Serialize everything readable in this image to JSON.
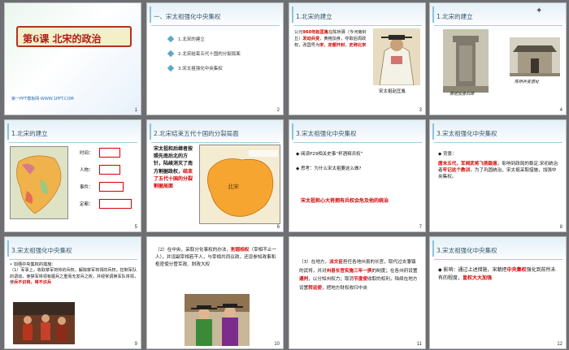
{
  "slides": [
    {
      "num": "1",
      "title": "第6课  北宋的政治",
      "watermark": "第一PPT模板网-WWW.1PPT.COM"
    },
    {
      "num": "2",
      "header": "一、宋太祖强化中央集权",
      "items": [
        "1.北宋的建立",
        "2.北宋结束五代十国的分裂局面",
        "3.宋太祖强化中央集权"
      ]
    },
    {
      "num": "3",
      "header": "1.北宋的建立",
      "text_parts": [
        "公元",
        "960年",
        "赵匡胤",
        "在陈桥驿（今河南封丘）",
        "发动兵变",
        "，黄袍加身，夺取后周政权，改国号为",
        "宋",
        "，",
        "定都开封",
        "，",
        "史称北宋"
      ],
      "caption": "宋太祖赵匡胤"
    },
    {
      "num": "4",
      "header": "1.北宋的建立",
      "caption1": "黄袍加身石碑",
      "caption2": "陈桥兵变遗址"
    },
    {
      "num": "5",
      "header": "1.北宋的建立",
      "fields": [
        "时间：",
        "人物：",
        "事件：",
        "定都："
      ]
    },
    {
      "num": "6",
      "header": "2.北宋结束五代十国的分裂局面",
      "text_black": "宋太祖和后继者按照先南后北的方针，陆续消灭了南方割据政权，",
      "text_red": "结束了五代十国的分裂割据局面",
      "map_label": "北宋"
    },
    {
      "num": "7",
      "header": "3.宋太祖强化中央集权",
      "q1": "阅读P29相关史事“杯酒释兵权”",
      "q2": "思考：为什么宋太祖要这么做?",
      "answer": "宋太祖担心大将拥有兵权会危及他的统治"
    },
    {
      "num": "8",
      "header": "3.宋太祖强化中央集权",
      "label": "背景：",
      "text_parts": [
        "唐末五代，",
        "军阀武将飞扬跋扈",
        "，影响到政局的稳定,宋初统治者",
        "牢记这个教训",
        "，为了巩固统治，宋太祖采取措施，加强中央集权。"
      ]
    },
    {
      "num": "9",
      "header": "3.宋太祖强化中央集权",
      "sub": "加强中央集权的措施：",
      "text_black": "（1）军事上，收取禁军将帅的兵权，解除禁军将领的兵权，控制军队的调动，使禁军将领有握兵之重而无发兵之权，并经常调换军队将领，使",
      "text_red": "兵不识将，将不识兵"
    },
    {
      "num": "10",
      "text_parts": [
        "（2）在中央，",
        "采取分化事权的办法，",
        "削弱相权",
        "（宰相不止一人），并设副宰相若干人，与宰相共同议政，还设参知政事和枢密使分管军政、财政大权"
      ]
    },
    {
      "num": "11",
      "text_parts": [
        "（3）在地方，",
        "派文臣",
        "担任各地州县的长官，取代过去藩镇的武将，并对",
        "州县长官实施三年一换",
        "的制度；在各州府设置",
        "通判",
        "，以分知州权力；取消",
        "节度使",
        "收取的权利，陆续在地方设置",
        "转运使",
        "，把地方财权收归中央"
      ]
    },
    {
      "num": "12",
      "header": "3.宋太祖强化中央集权",
      "text_parts": [
        "影响：通过上述措施，宋朝把",
        "中央集权",
        "强化到前所未有的程度，",
        "皇权大大加强"
      ]
    }
  ],
  "colors": {
    "accent_red": "#d40000",
    "header_blue": "#35546a",
    "title_red": "#b01c1c"
  }
}
